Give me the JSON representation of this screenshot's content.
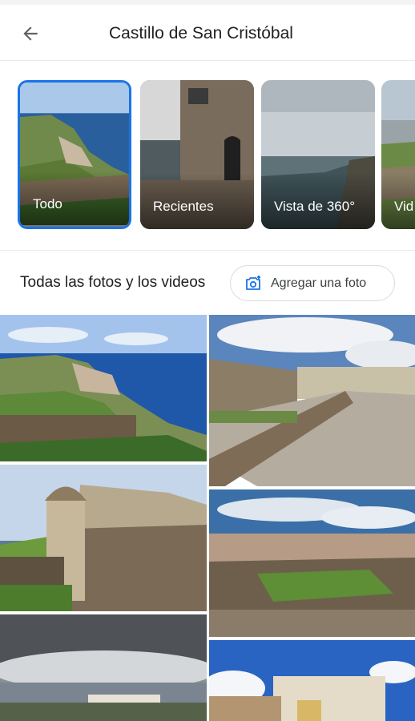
{
  "header": {
    "title": "Castillo de San Cristóbal",
    "back_icon": "arrow-back-icon"
  },
  "categories": [
    {
      "label": "Todo",
      "selected": true
    },
    {
      "label": "Recientes",
      "selected": false
    },
    {
      "label": "Vista de 360°",
      "selected": false
    },
    {
      "label": "Vid",
      "selected": false
    }
  ],
  "section": {
    "title": "Todas las fotos y los videos",
    "add_photo_label": "Agregar una foto",
    "add_photo_icon": "add-photo-camera-icon"
  },
  "colors": {
    "accent": "#1a73e8",
    "text": "#202124",
    "divider": "#e8eaed"
  }
}
